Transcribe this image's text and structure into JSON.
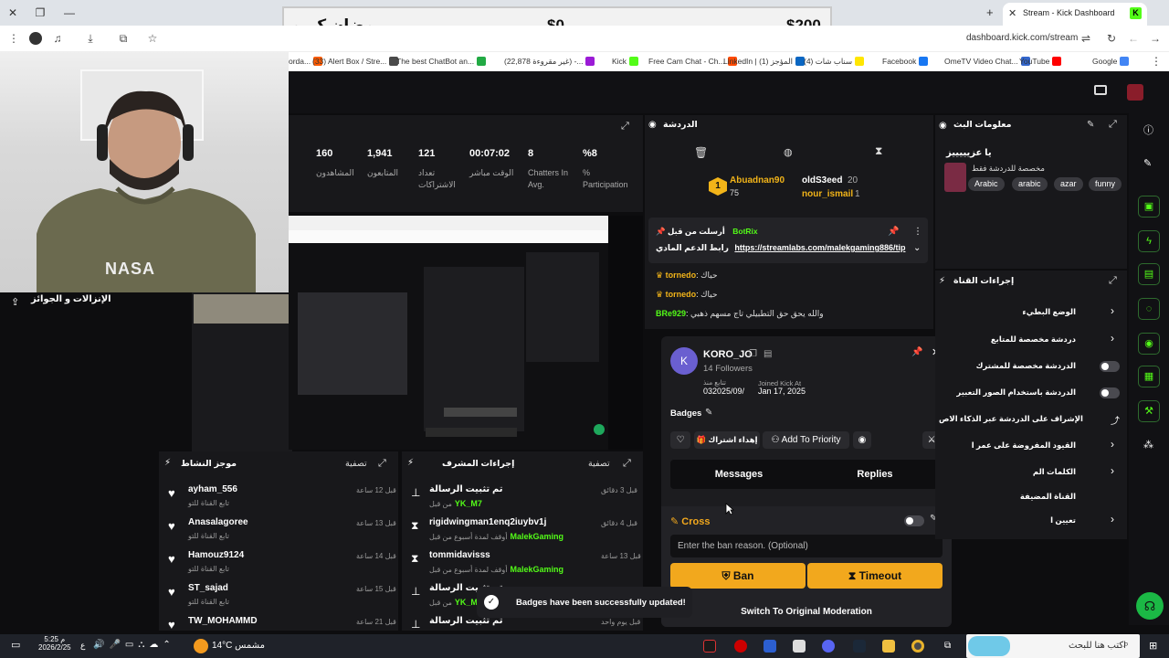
{
  "browser": {
    "tab_title": "Stream - Kick Dashboard",
    "url": "dashboard.kick.com/stream",
    "bookmarks": [
      {
        "label": "orda...",
        "color": "#ff5b00"
      },
      {
        "label": "(33) Alert Box / Stre...",
        "color": "#4a4a4a"
      },
      {
        "label": "The best ChatBot an...",
        "color": "#22aa44"
      },
      {
        "label": "(22,878 غير مقروءة) -...",
        "color": "#9b1bd6"
      },
      {
        "label": "Kick",
        "color": "#53fc18"
      },
      {
        "label": "Free Cam Chat - Ch...",
        "color": "#ff4a00"
      },
      {
        "label": "LinkedIn | (1) المؤجز",
        "color": "#0a66c2"
      },
      {
        "label": "(4) سناب شات",
        "color": "#ffe600"
      },
      {
        "label": "Facebook",
        "color": "#1877f2"
      },
      {
        "label": "OmeTV Video Chat...",
        "color": "#3366cc"
      },
      {
        "label": "YouTube",
        "color": "#ff0000"
      },
      {
        "label": "Google",
        "color": "#4285f4"
      }
    ]
  },
  "overlay": {
    "title": "رمضان كريم",
    "current": "$0",
    "goal": "$200"
  },
  "webcam": {
    "shirt_text": "NASA",
    "gifts_title": "الإنزالات و الجوائز"
  },
  "stats": [
    {
      "value": "160",
      "label": "المشاهدون"
    },
    {
      "value": "1,941",
      "label": "المتابعون"
    },
    {
      "value": "121",
      "label": "تعداد الاشتراكات"
    },
    {
      "value": "00:07:02",
      "label": "الوقت مباشر"
    },
    {
      "value": "8",
      "label": "Chatters In Avg."
    },
    {
      "value": "%8",
      "label": "% Participation"
    }
  ],
  "activity": {
    "title": "موجز النشاط",
    "filter": "تصفية",
    "items": [
      {
        "name": "ayham_556",
        "sub": "تابع القناة للتو",
        "time": "قبل 12 ساعة"
      },
      {
        "name": "Anasalagoree",
        "sub": "تابع القناة للتو",
        "time": "قبل 13 ساعة"
      },
      {
        "name": "Hamouz9124",
        "sub": "تابع القناة للتو",
        "time": "قبل 14 ساعة"
      },
      {
        "name": "ST_sajad",
        "sub": "تابع القناة للتو",
        "time": "قبل 15 ساعة"
      },
      {
        "name": "TW_MOHAMMD",
        "sub": "",
        "time": "قبل 21 ساعة"
      }
    ]
  },
  "modactions": {
    "title": "إجراءات المشرف",
    "filter": "تصفية",
    "items": [
      {
        "icon": "pin",
        "name": "تم تثبيت الرسالة",
        "sub": "من قبل",
        "sub_user": "YK_M7",
        "time": "قبل 3 دقائق"
      },
      {
        "icon": "timeout",
        "name": "rigidwingman1enq2iuybv1j",
        "sub": "أوقف لمدة أسبوع من قبل",
        "sub_user": "MalekGaming",
        "time": "قبل 4 دقائق"
      },
      {
        "icon": "timeout",
        "name": "tommidavisss",
        "sub": "أوقف لمدة أسبوع من قبل",
        "sub_user": "MalekGaming",
        "time": "قبل 13 ساعة"
      },
      {
        "icon": "pin",
        "name": "تم تثبيت الرسالة",
        "sub": "من قبل",
        "sub_user": "YK_M7",
        "time": ""
      },
      {
        "icon": "pin",
        "name": "تم تثبيت الرسالة",
        "sub": "",
        "sub_user": "",
        "time": "قبل يوم واحد"
      }
    ]
  },
  "chat": {
    "title": "الدردشة",
    "top_gifters": [
      {
        "name": "Abuadnan90",
        "count": "75"
      },
      {
        "name": "oldS3eed",
        "count": "20"
      },
      {
        "name": "nour_ismail",
        "count": "1"
      }
    ],
    "pinned": {
      "header": "أرسلت من قبل",
      "user": "BotRix",
      "text": "رابط الدعم المادي",
      "link": "https://streamlabs.com/malekgaming886/tip"
    },
    "messages": [
      {
        "user": "tornedo",
        "text": "حياك"
      },
      {
        "user": "tornedo",
        "text": "حياك"
      },
      {
        "user": "BRe929",
        "text": "والله يحق حق التطبيلي تاج مسهم ذهبي"
      }
    ]
  },
  "usercard": {
    "username": "KORO_JO",
    "followers": "14 Followers",
    "following_label": "تتابع منذ",
    "following_date": "032025/09/",
    "joined_label": "Joined Kick At",
    "joined_date": "Jan 17, 2025",
    "badges_label": "Badges",
    "gift_sub": "إهداء اشتراك",
    "add_priority": "Add To Priority",
    "tab_messages": "Messages",
    "tab_replies": "Replies",
    "cross_label": "Cross",
    "ban_placeholder": "Enter the ban reason. (Optional)",
    "ban": "Ban",
    "timeout": "Timeout",
    "switch": "Switch To Original Moderation"
  },
  "botinfo": {
    "title": "معلومات البث",
    "name": "يا عزيييييز",
    "subtitle": "مخصصة للدردشة فقط",
    "tags": [
      "Arabic",
      "arabic",
      "azar",
      "funny"
    ]
  },
  "chactions": {
    "title": "إجراءات القناة",
    "items": [
      {
        "label": "الوضع البطيء",
        "kind": "chevron"
      },
      {
        "label": "دردشة مخصصة للمتابع",
        "kind": "chevron"
      },
      {
        "label": "الدردشة مخصصة للمشترك",
        "kind": "toggle"
      },
      {
        "label": "الدردشة باستخدام الصور التعبير",
        "kind": "toggle"
      },
      {
        "label": "الإشراف على الدردشة عبر الذكاء الاص",
        "kind": "link"
      },
      {
        "label": "القيود المفروضة على عمر ا",
        "kind": "chevron"
      },
      {
        "label": "الكلمات الم",
        "kind": "chevron"
      },
      {
        "label": "القناة المضيفة",
        "kind": "none"
      },
      {
        "label": "تعيين ا",
        "kind": "chevron"
      }
    ]
  },
  "toast": {
    "text": "Badges have been successfully updated!"
  },
  "taskbar": {
    "time": "5:25 م",
    "date": "2026/2/25",
    "weather": "14°C مشمس",
    "search_placeholder": "اكتب هنا للبحث",
    "lang": "ع"
  }
}
